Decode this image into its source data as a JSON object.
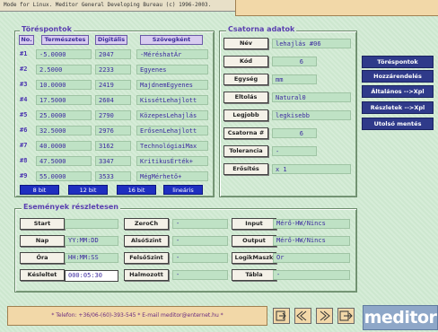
{
  "window_title": "Mode for Linux. Meditor General Developing Bureau (c) 1996-2003.",
  "trigger_panel": {
    "title": "Töréspontok",
    "headers": [
      "No.",
      "Természetes",
      "Digitális",
      "Szövegként"
    ],
    "rows": [
      {
        "no": "#1",
        "nat": "-5.0000",
        "dig": "2047",
        "txt": "-MéréshatÁr"
      },
      {
        "no": "#2",
        "nat": "2.5000",
        "dig": "2233",
        "txt": "Egyenes"
      },
      {
        "no": "#3",
        "nat": "10.0000",
        "dig": "2419",
        "txt": "MajdnemEgyenes"
      },
      {
        "no": "#4",
        "nat": "17.5000",
        "dig": "2604",
        "txt": "KissétLehajlott"
      },
      {
        "no": "#5",
        "nat": "25.0000",
        "dig": "2790",
        "txt": "KözepesLehajlás"
      },
      {
        "no": "#6",
        "nat": "32.5000",
        "dig": "2976",
        "txt": "ErősenLehajlott"
      },
      {
        "no": "#7",
        "nat": "40.0000",
        "dig": "3162",
        "txt": "TechnológiaiMax"
      },
      {
        "no": "#8",
        "nat": "47.5000",
        "dig": "3347",
        "txt": "KritikusÉrték+"
      },
      {
        "no": "#9",
        "nat": "55.0000",
        "dig": "3533",
        "txt": "MégMérhető+"
      }
    ],
    "bit_buttons": [
      "8 bit",
      "12 bit",
      "16 bit",
      "lineáris"
    ]
  },
  "channel_panel": {
    "title": "Csatorna adatok",
    "rows": [
      {
        "label": "Név",
        "value": "lehajlás #06"
      },
      {
        "label": "Kód",
        "value": "6"
      },
      {
        "label": "Egység",
        "value": "mm"
      },
      {
        "label": "Eltolás",
        "value": "Natural0"
      },
      {
        "label": "Legjobb",
        "value": "legkisebb"
      },
      {
        "label": "Csatorna #",
        "value": "6"
      },
      {
        "label": "Tolerancia",
        "value": "-"
      },
      {
        "label": "Erősítés",
        "value": "x 1"
      }
    ]
  },
  "side_menu": [
    "Töréspontok",
    "Hozzárendelés",
    "Általános -->Xpl",
    "Részletek -->Xpl",
    "Utolsó mentés"
  ],
  "events_panel": {
    "title": "Események részletesen",
    "col1": [
      {
        "label": "Start",
        "value": ""
      },
      {
        "label": "Nap",
        "value": "YY:MM:DD"
      },
      {
        "label": "Óra",
        "value": "HH:MM:SS"
      },
      {
        "label": "Késleltet",
        "value": "000:05:30"
      }
    ],
    "col2": [
      {
        "label": "ZeroCh",
        "value": "-"
      },
      {
        "label": "AlsóSzint",
        "value": "-"
      },
      {
        "label": "FelsőSzint",
        "value": "-"
      },
      {
        "label": "Halmozott",
        "value": "-"
      }
    ],
    "col3": [
      {
        "label": "Input",
        "value": "Mérő-HW/Nincs"
      },
      {
        "label": "Output",
        "value": "Mérő-HW/Nincs"
      },
      {
        "label": "LogikMaszk",
        "value": "Or"
      },
      {
        "label": "Tábla",
        "value": "-"
      }
    ]
  },
  "footer": {
    "text": "* Telefon: +36/06-(60)-393-545 * E-mail meditor@enternet.hu *"
  },
  "toolbar_icons": [
    "import-icon",
    "undo-icon",
    "redo-icon",
    "exit-icon"
  ],
  "logo": "meditor",
  "colors": {
    "background": "#cfe8d2",
    "accent": "#2f3a8a",
    "header": "#5a3fb0",
    "field": "#bfe2c5"
  }
}
